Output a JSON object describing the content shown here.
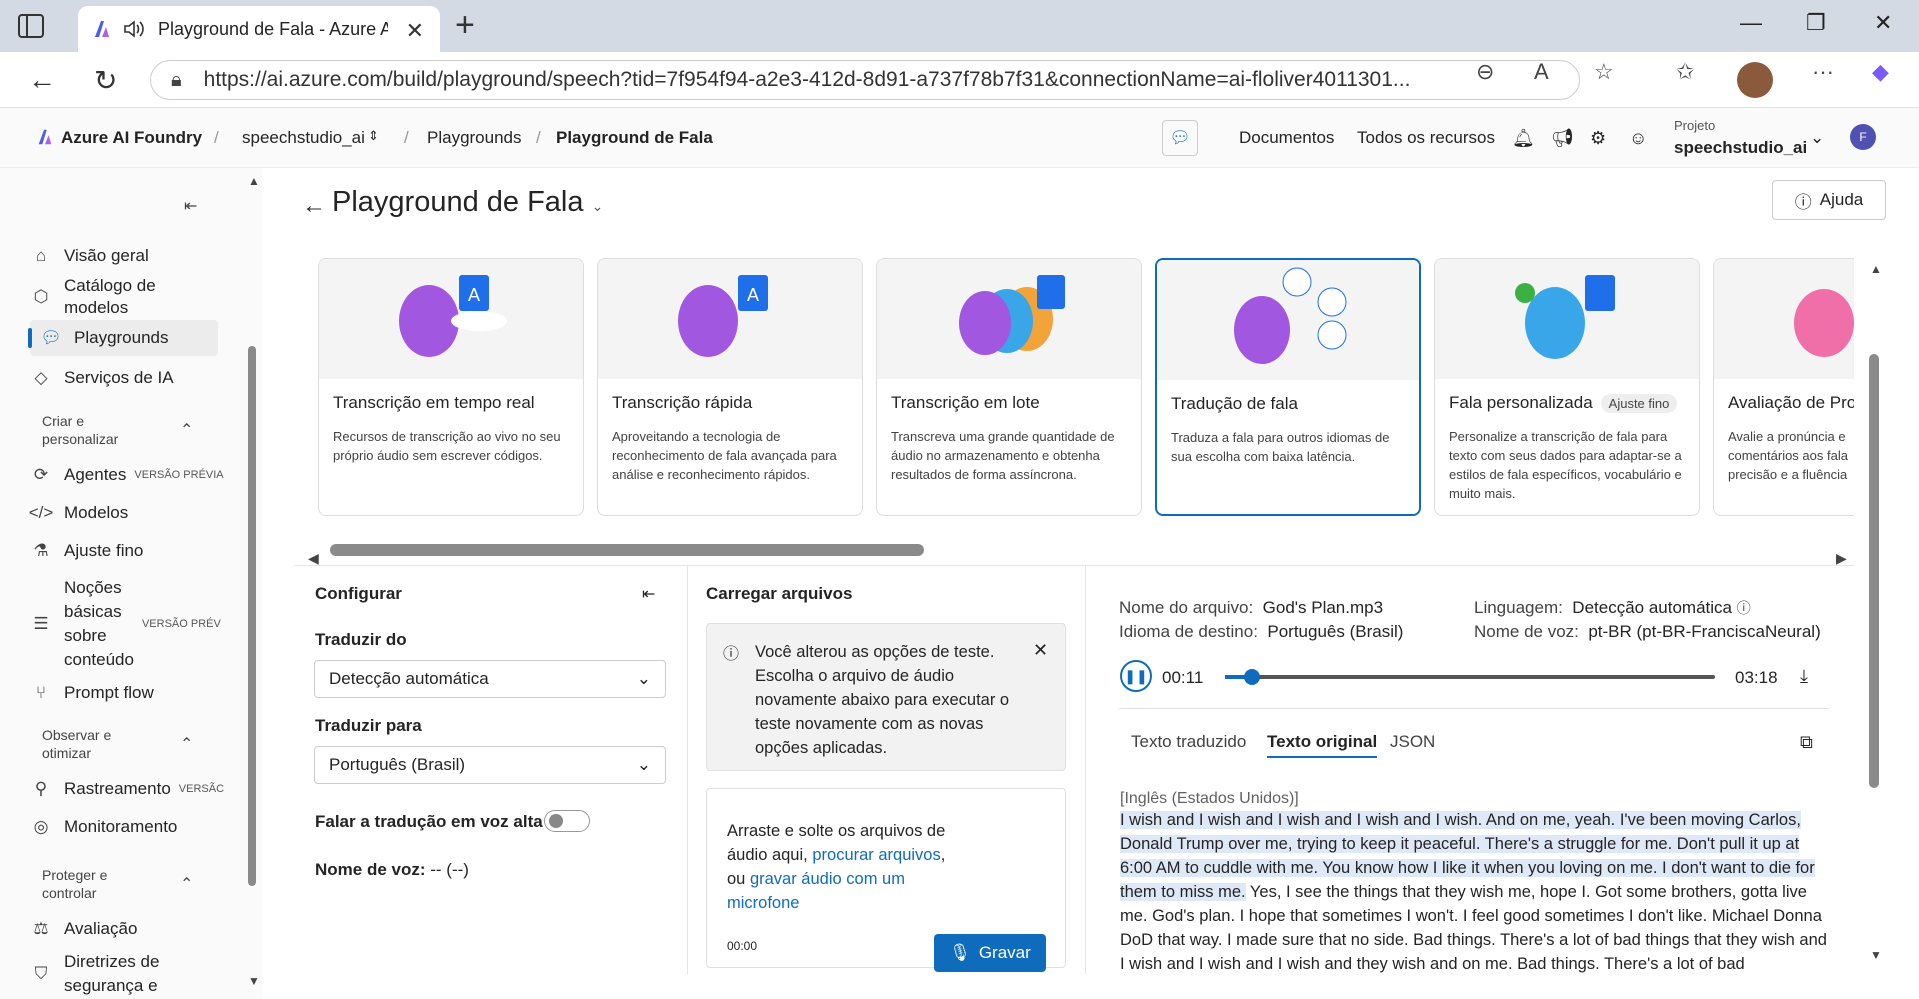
{
  "browser": {
    "tab_title": "Playground de Fala - Azure AI Foundry",
    "url": "https://ai.azure.com/build/playground/speech?tid=7f954f94-a2e3-412d-8d91-a737f78b7f31&connectionName=ai-floliver4011301..."
  },
  "header": {
    "brand": "Azure AI Foundry",
    "project_crumb": "speechstudio_ai",
    "crumb_playgrounds": "Playgrounds",
    "crumb_current": "Playground de Fala",
    "docs": "Documentos",
    "all_resources": "Todos os recursos",
    "project_label": "Projeto",
    "project_name": "speechstudio_ai",
    "user_initial": "F"
  },
  "sidebar": {
    "items": [
      {
        "label": "Visão geral",
        "icon": "home-icon"
      },
      {
        "label": "Catálogo de modelos",
        "icon": "cube-icon"
      },
      {
        "label": "Playgrounds",
        "icon": "chat-icon"
      },
      {
        "label": "Serviços de IA",
        "icon": "diamond-icon"
      }
    ],
    "section_create": "Criar e personalizar",
    "create_items": [
      {
        "label": "Agentes",
        "badge": "VERSÃO PRÉVIA"
      },
      {
        "label": "Modelos"
      },
      {
        "label": "Ajuste fino"
      },
      {
        "label": "Noções básicas sobre conteúdo",
        "badge": "VERSÃO PRÉV"
      },
      {
        "label": "Prompt flow"
      }
    ],
    "section_observe": "Observar e otimizar",
    "observe_items": [
      {
        "label": "Rastreamento",
        "badge": "VERSÃC"
      },
      {
        "label": "Monitoramento"
      }
    ],
    "section_protect": "Proteger e controlar",
    "protect_items": [
      {
        "label": "Avaliação"
      },
      {
        "label": "Diretrizes de segurança e"
      }
    ]
  },
  "main": {
    "title": "Playground de Fala",
    "help": "Ajuda",
    "cards": [
      {
        "title": "Transcrição em tempo real",
        "desc": "Recursos de transcrição ao vivo no seu próprio áudio sem escrever códigos."
      },
      {
        "title": "Transcrição rápida",
        "desc": "Aproveitando a tecnologia de reconhecimento de fala avançada para análise e reconhecimento rápidos."
      },
      {
        "title": "Transcrição em lote",
        "desc": "Transcreva uma grande quantidade de áudio no armazenamento e obtenha resultados de forma assíncrona."
      },
      {
        "title": "Tradução de fala",
        "desc": "Traduza a fala para outros idiomas de sua escolha com baixa latência."
      },
      {
        "title": "Fala personalizada",
        "tag": "Ajuste fino",
        "desc": "Personalize a transcrição de fala para texto com seus dados para adaptar-se a estilos de fala específicos, vocabulário e muito mais."
      },
      {
        "title": "Avaliação de Pro",
        "desc": "Avalie a pronúncia e comentários aos fala precisão e a fluência"
      }
    ]
  },
  "config": {
    "title": "Configurar",
    "from_label": "Traduzir do",
    "from_value": "Detecção automática",
    "to_label": "Traduzir para",
    "to_value": "Português (Brasil)",
    "speak_label": "Falar a tradução em voz alta",
    "voice_label": "Nome de voz:",
    "voice_value": "-- (--)"
  },
  "upload": {
    "title": "Carregar arquivos",
    "notice": "Você alterou as opções de teste. Escolha o arquivo de áudio novamente abaixo para executar o teste novamente com as novas opções aplicadas.",
    "drop_text": "Arraste e solte os arquivos de áudio aqui,",
    "browse": "procurar arquivos",
    "or": ", ou",
    "record_link": "gravar áudio com um microfone",
    "timer": "00:00",
    "record_btn": "Gravar"
  },
  "result": {
    "file_label": "Nome do arquivo:",
    "file_value": "God's Plan.mp3",
    "lang_label": "Linguagem:",
    "lang_value": "Detecção automática",
    "target_label": "Idioma de destino:",
    "target_value": "Português (Brasil)",
    "voice_label": "Nome de voz:",
    "voice_value": "pt-BR (pt-BR-FranciscaNeural)",
    "time_current": "00:11",
    "time_total": "03:18",
    "progress": 0.055,
    "tab_translated": "Texto traduzido",
    "tab_original": "Texto original",
    "tab_json": "JSON",
    "source_lang": "[Inglês (Estados Unidos)]",
    "text_highlight": "I wish and I wish and I wish and I wish and I wish. And on me, yeah. I've been moving Carlos, Donald Trump over me, trying to keep it peaceful. There's a struggle for me. Don't pull it up at 6:00 AM to cuddle with me. You know how I like it when you loving on me. I don't want to die for them to miss me.",
    "text_rest": " Yes, I see the things that they wish me, hope I. Got some brothers, gotta live me. God's plan. I hope that sometimes I won't. I feel good sometimes I don't like. Michael Donna DoD that way. I made sure that no side. Bad things. There's a lot of bad things that they wish and I wish and I wish and I wish and they wish and on me. Bad things. There's a lot of bad"
  }
}
